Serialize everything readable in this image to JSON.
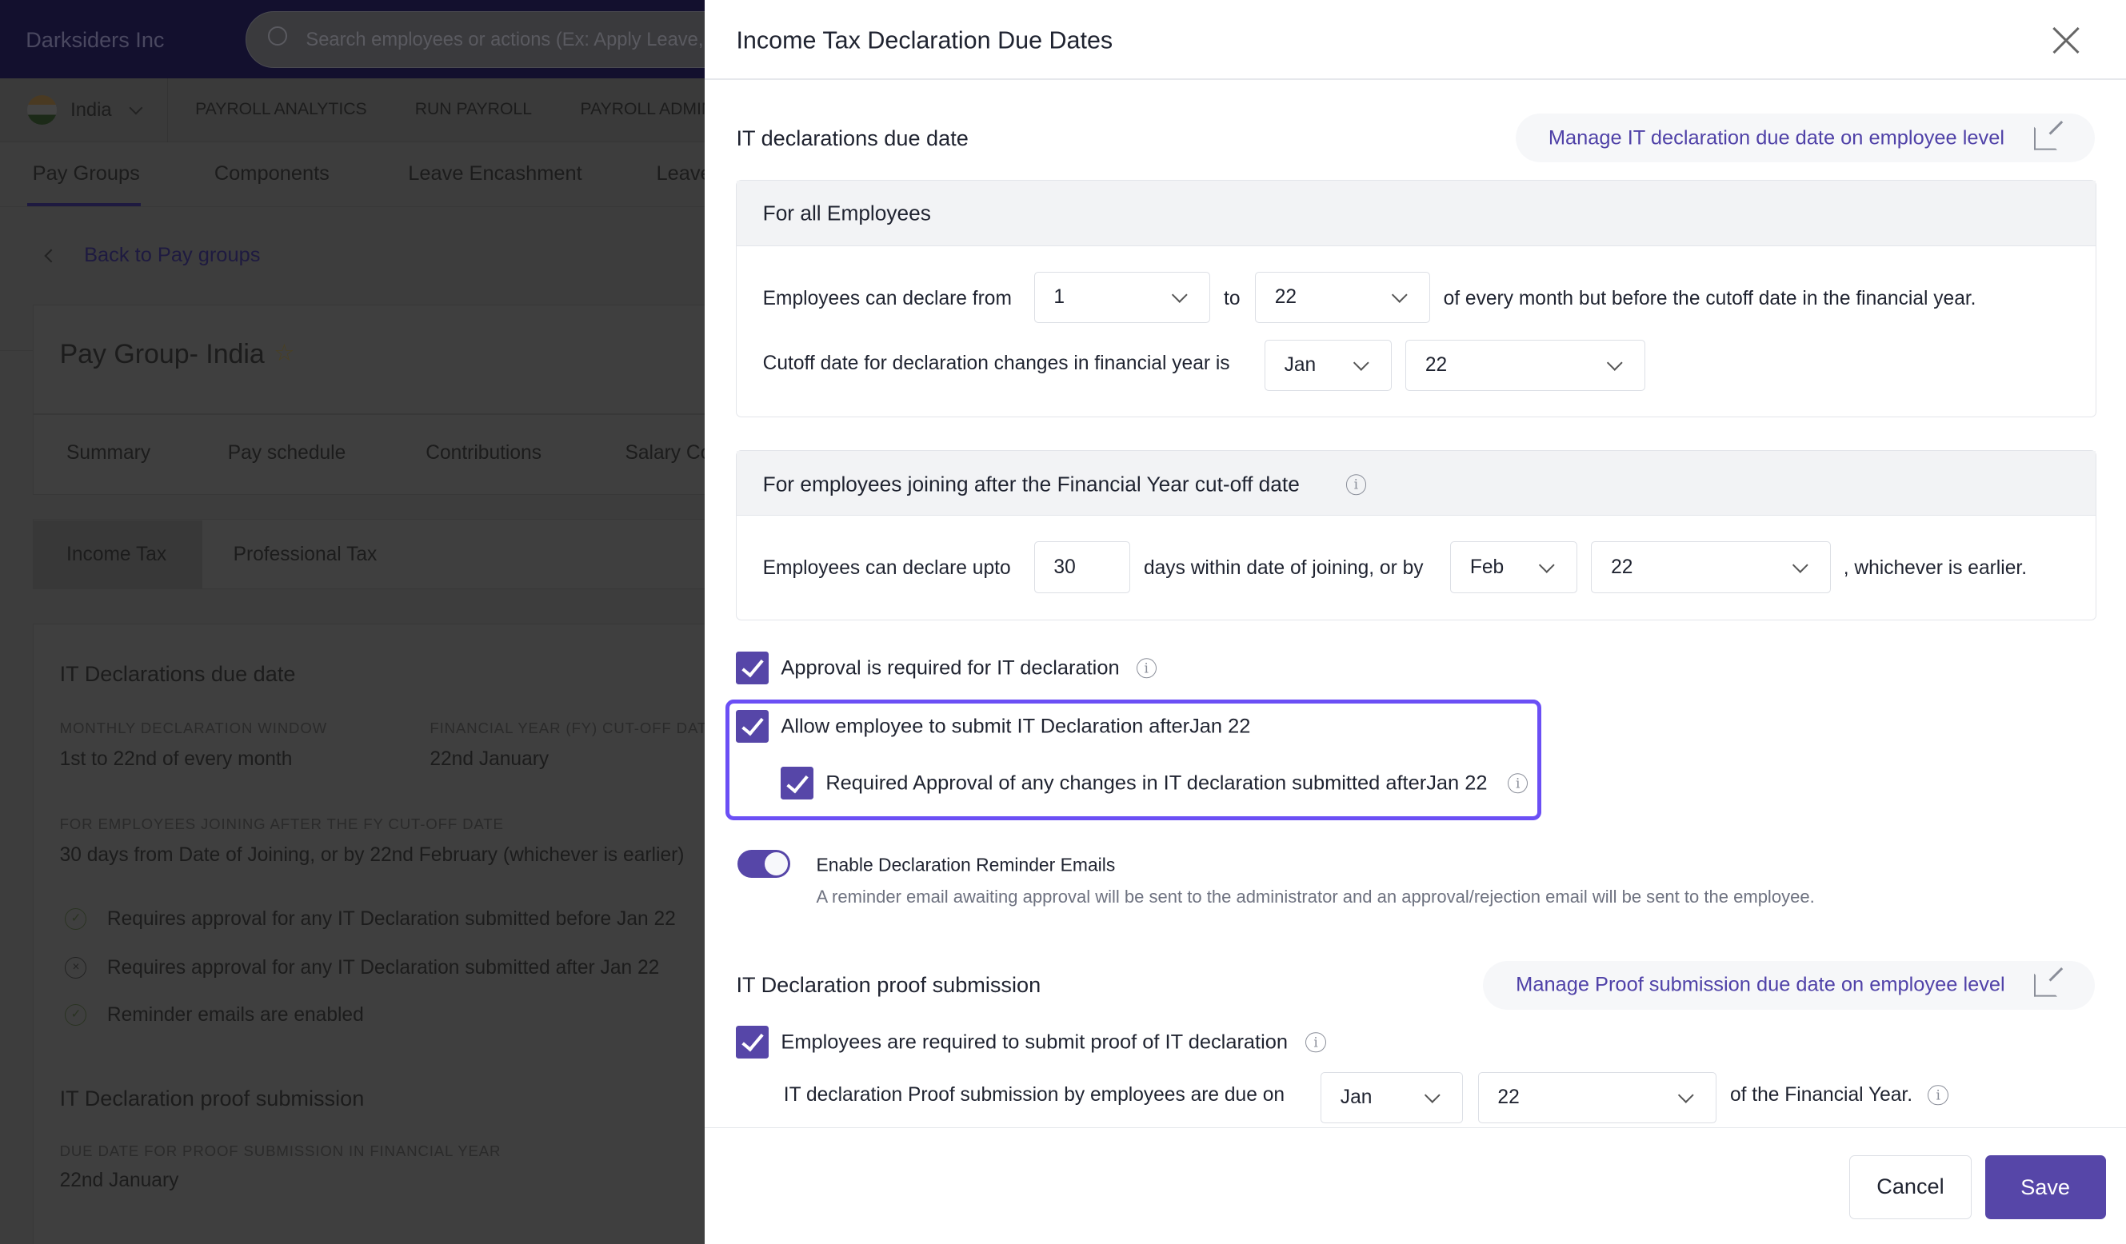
{
  "background": {
    "company": "Darksiders Inc",
    "search_placeholder": "Search employees or actions (Ex: Apply Leave, Add Employee)",
    "country": "India",
    "nav": [
      "PAYROLL ANALYTICS",
      "RUN PAYROLL",
      "PAYROLL ADMIN"
    ],
    "tabs": [
      "Pay Groups",
      "Components",
      "Leave Encashment",
      "Leave"
    ],
    "back": "Back to Pay groups",
    "pay_group_title": "Pay Group- India",
    "sub_tabs": [
      "Summary",
      "Pay schedule",
      "Contributions",
      "Salary Components"
    ],
    "tax_tabs": [
      "Income Tax",
      "Professional Tax"
    ],
    "section1_title": "IT Declarations due date",
    "monthly_label": "MONTHLY DECLARATION WINDOW",
    "monthly_value": "1st to 22nd of every month",
    "fy_label": "FINANCIAL YEAR (FY) CUT-OFF DATE",
    "fy_value": "22nd January",
    "joining_label": "FOR EMPLOYEES JOINING AFTER THE FY CUT-OFF DATE",
    "joining_value": "30 days from Date of Joining, or by 22nd February (whichever is earlier)",
    "status_items": [
      {
        "icon": "check-circle-icon",
        "text": "Requires approval for any IT Declaration submitted before Jan 22"
      },
      {
        "icon": "x-circle-icon",
        "text": "Requires approval for any IT Declaration submitted after Jan 22"
      },
      {
        "icon": "check-circle-icon",
        "text": "Reminder emails are enabled"
      }
    ],
    "section2_title": "IT Declaration proof submission",
    "proof_label": "DUE DATE FOR PROOF SUBMISSION IN FINANCIAL YEAR",
    "proof_value": "22nd January"
  },
  "drawer": {
    "title": "Income Tax Declaration Due Dates",
    "section1": {
      "title": "IT declarations due date",
      "manage_link": "Manage IT declaration due date on employee level",
      "all_employees": {
        "title": "For all Employees",
        "declare_from_label": "Employees can declare from",
        "from_value": "1",
        "to_label": "to",
        "to_value": "22",
        "suffix": "of every month but before the cutoff date in the financial year.",
        "cutoff_label": "Cutoff date for declaration changes in financial year is",
        "cutoff_month": "Jan",
        "cutoff_day": "22"
      },
      "joining": {
        "title": "For employees joining after the Financial Year cut-off date",
        "upto_label": "Employees can declare upto",
        "days_value": "30",
        "within_label": "days within date of joining, or by",
        "month": "Feb",
        "day": "22",
        "suffix": ", whichever is earlier."
      },
      "approval_required": {
        "label": "Approval is required for IT declaration",
        "checked": true
      },
      "allow_after": {
        "label": "Allow employee to submit IT Declaration afterJan 22",
        "checked": true
      },
      "approval_changes": {
        "label": "Required Approval of any changes in IT declaration submitted afterJan 22",
        "checked": true
      },
      "reminder": {
        "label": "Enable Declaration Reminder Emails",
        "enabled": true,
        "description": "A reminder email awaiting approval will be sent to the administrator and an approval/rejection email will be sent to the employee."
      }
    },
    "section2": {
      "title": "IT Declaration proof submission",
      "manage_link": "Manage Proof submission due date on employee level",
      "proof_required": {
        "label": "Employees are required to submit proof of IT declaration",
        "checked": true
      },
      "due_label": "IT declaration Proof submission by employees are due on",
      "month": "Jan",
      "day": "22",
      "suffix": "of the Financial Year."
    },
    "cancel": "Cancel",
    "save": "Save"
  },
  "colors": {
    "accent": "#5646a8",
    "highlight": "#6b4ff5",
    "link": "#5042a8"
  }
}
